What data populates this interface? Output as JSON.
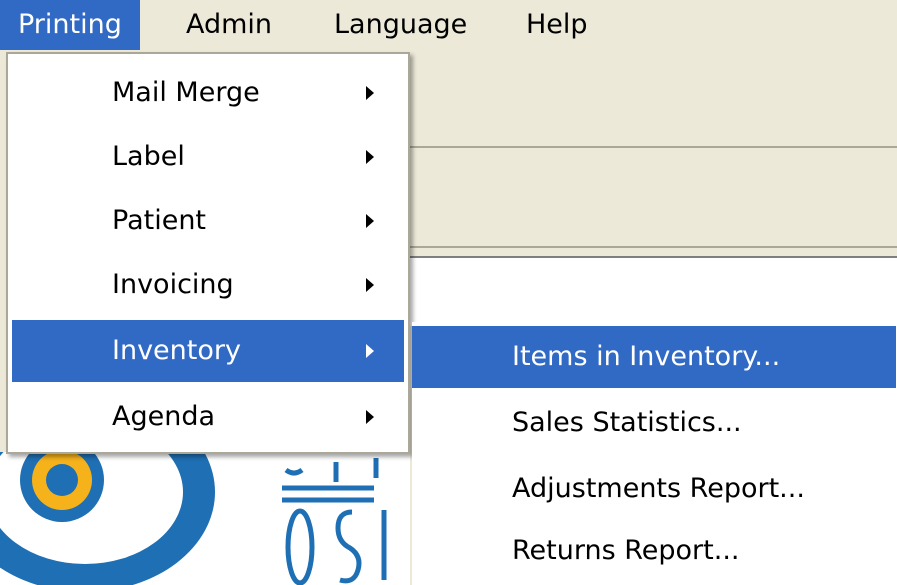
{
  "menubar": {
    "items": [
      {
        "label": "Printing",
        "active": true
      },
      {
        "label": "Admin",
        "active": false
      },
      {
        "label": "Language",
        "active": false
      },
      {
        "label": "Help",
        "active": false
      }
    ]
  },
  "printing_menu": {
    "items": [
      {
        "label": "Mail Merge",
        "submenu": true
      },
      {
        "label": "Label",
        "submenu": true
      },
      {
        "label": "Patient",
        "submenu": true
      },
      {
        "label": "Invoicing",
        "submenu": true
      },
      {
        "label": "Inventory",
        "submenu": true,
        "highlighted": true
      },
      {
        "label": "Agenda",
        "submenu": true
      }
    ]
  },
  "inventory_submenu": {
    "items": [
      {
        "label": "Items in Inventory...",
        "highlighted": true
      },
      {
        "label": "Sales Statistics..."
      },
      {
        "label": "Adjustments Report..."
      },
      {
        "label": "Returns Report..."
      }
    ]
  },
  "colors": {
    "highlight": "#316ac5",
    "menu_bg": "#ffffff",
    "chrome": "#ece9d8",
    "logo_blue": "#1e6fb4",
    "logo_yellow": "#f6b21a"
  },
  "icons": [
    "submenu-arrow-icon",
    "eye-logo"
  ]
}
